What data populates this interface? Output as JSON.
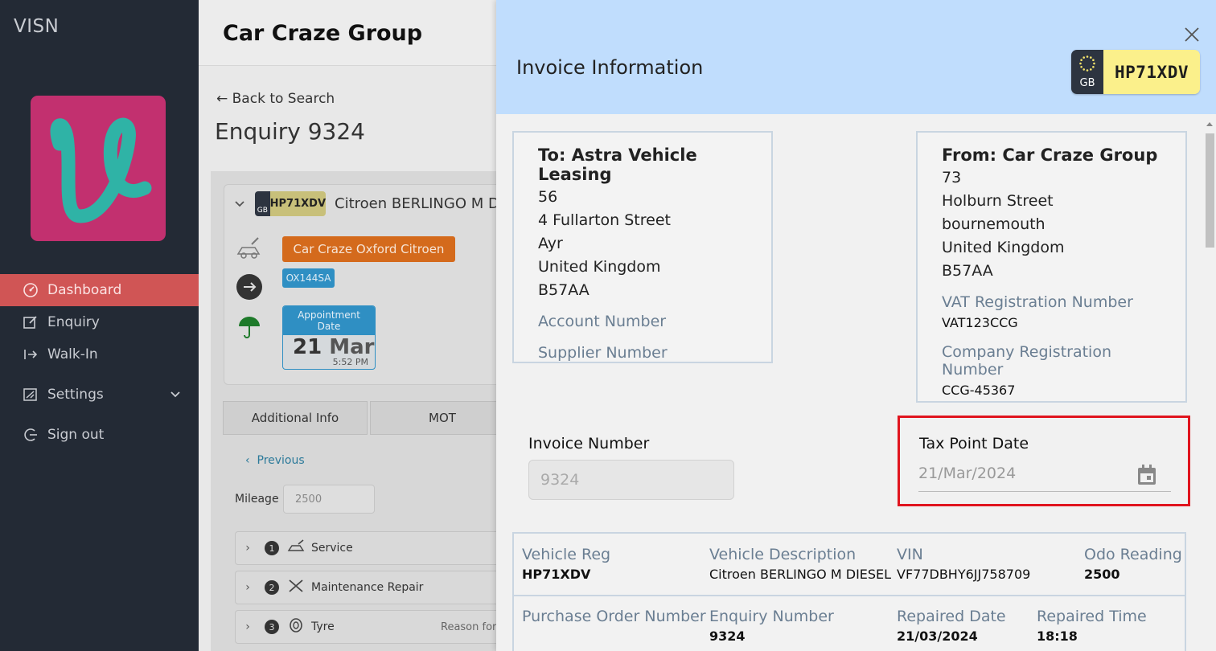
{
  "sidebar": {
    "brand": "VISN",
    "items": [
      {
        "label": "Dashboard",
        "icon": "gauge-icon"
      },
      {
        "label": "Enquiry",
        "icon": "edit-icon"
      },
      {
        "label": "Walk-In",
        "icon": "enter-icon"
      },
      {
        "label": "Settings",
        "icon": "settings-icon"
      },
      {
        "label": "Sign out",
        "icon": "sign-out-icon"
      }
    ]
  },
  "background": {
    "company": "Car Craze Group",
    "back_label": "← Back to Search",
    "enquiry_title": "Enquiry 9324",
    "vehicle": {
      "plate_country": "GB",
      "plate": "HP71XDV",
      "title": "Citroen BERLINGO M DIESEL",
      "dealer": "Car Craze Oxford Citroen",
      "dealer_code": "OX144SA",
      "appointment_label": "Appointment Date",
      "appointment_day": "21",
      "appointment_month": "Mar",
      "appointment_time": "5:52 PM"
    },
    "tabs": [
      "Additional Info",
      "MOT"
    ],
    "previous_label": "Previous",
    "mileage_label": "Mileage",
    "mileage_value": "2500",
    "jobs": [
      {
        "num": "1",
        "label": "Service"
      },
      {
        "num": "2",
        "label": "Maintenance Repair"
      },
      {
        "num": "3",
        "label": "Tyre",
        "extra": "Reason for a"
      }
    ]
  },
  "panel": {
    "title": "Invoice Information",
    "plate_country": "GB",
    "plate": "HP71XDV",
    "to": {
      "heading": "To: Astra Vehicle Leasing",
      "lines": [
        "56",
        "4 Fullarton Street",
        "Ayr",
        "United Kingdom",
        "B57AA"
      ],
      "account_label": "Account Number",
      "supplier_label": "Supplier Number"
    },
    "from": {
      "heading": "From: Car Craze Group",
      "lines": [
        "73",
        "Holburn Street",
        "bournemouth",
        "United Kingdom",
        "B57AA"
      ],
      "vat_label": "VAT Registration Number",
      "vat_value": "VAT123CCG",
      "company_reg_label": "Company Registration Number",
      "company_reg_value": "CCG-45367"
    },
    "invoice_number_label": "Invoice Number",
    "invoice_number_value": "9324",
    "tax_point_label": "Tax Point Date",
    "tax_point_value": "21/Mar/2024",
    "details": {
      "vehicle_reg_label": "Vehicle Reg",
      "vehicle_reg_value": "HP71XDV",
      "vehicle_desc_label": "Vehicle Description",
      "vehicle_desc_value": "Citroen BERLINGO M DIESEL",
      "vin_label": "VIN",
      "vin_value": "VF77DBHY6JJ758709",
      "odo_label": "Odo Reading",
      "odo_value": "2500",
      "po_label": "Purchase Order Number",
      "enquiry_label": "Enquiry Number",
      "enquiry_value": "9324",
      "repaired_date_label": "Repaired Date",
      "repaired_date_value": "21/03/2024",
      "repaired_time_label": "Repaired Time",
      "repaired_time_value": "18:18"
    }
  },
  "colors": {
    "sidebar_bg": "#232a35",
    "active_nav": "#d05555",
    "panel_header": "#c0ddfd",
    "plate_yellow": "#fbf08b",
    "highlight_red": "#e0141e",
    "logo_pink": "#c2306f",
    "logo_teal": "#2fb3a6"
  }
}
